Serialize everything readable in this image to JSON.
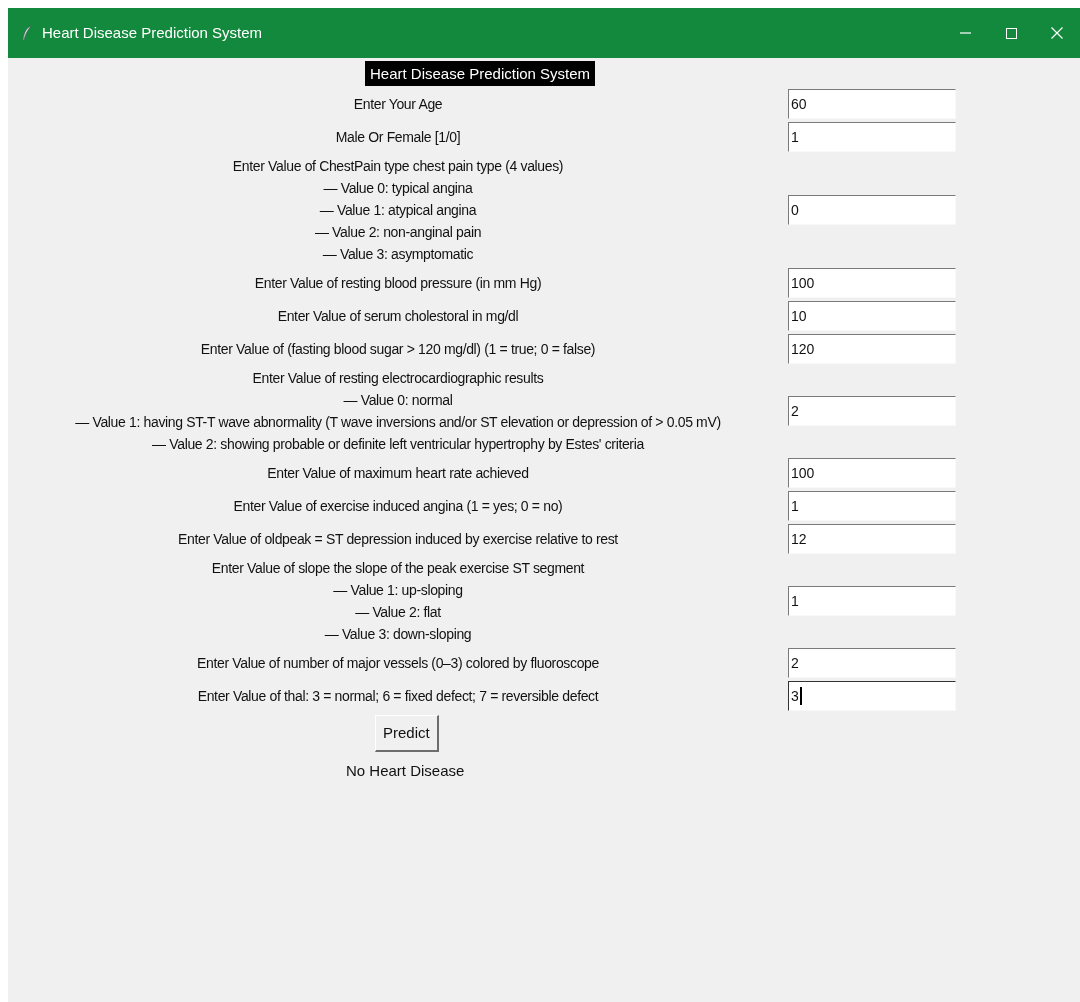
{
  "window": {
    "title": "Heart Disease Prediction System"
  },
  "heading": "Heart Disease Prediction System",
  "fields": [
    {
      "label_lines": [
        "Enter Your Age"
      ],
      "value": "60",
      "focused": false
    },
    {
      "label_lines": [
        "Male Or Female [1/0]"
      ],
      "value": "1",
      "focused": false
    },
    {
      "label_lines": [
        "Enter Value of ChestPain type chest pain type (4 values)",
        "— Value 0: typical angina",
        "— Value 1: atypical angina",
        "— Value 2: non-anginal pain",
        "— Value 3: asymptomatic"
      ],
      "value": "0",
      "focused": false
    },
    {
      "label_lines": [
        "Enter Value of resting blood pressure (in mm Hg)"
      ],
      "value": "100",
      "focused": false
    },
    {
      "label_lines": [
        "Enter Value of serum cholestoral in mg/dl"
      ],
      "value": "10",
      "focused": false
    },
    {
      "label_lines": [
        "Enter Value of (fasting blood sugar > 120 mg/dl) (1 = true; 0 = false)"
      ],
      "value": "120",
      "focused": false
    },
    {
      "label_lines": [
        "Enter Value of resting electrocardiographic results",
        "— Value 0: normal",
        "— Value 1: having ST-T wave abnormality (T wave inversions and/or ST elevation or depression of > 0.05 mV)",
        "— Value 2: showing probable or definite left ventricular hypertrophy by Estes' criteria"
      ],
      "value": "2",
      "focused": false
    },
    {
      "label_lines": [
        "Enter Value of maximum heart rate achieved"
      ],
      "value": "100",
      "focused": false
    },
    {
      "label_lines": [
        "Enter Value of exercise induced angina (1 = yes; 0 = no)"
      ],
      "value": "1",
      "focused": false
    },
    {
      "label_lines": [
        "Enter Value of oldpeak = ST depression induced by exercise relative to rest"
      ],
      "value": "12",
      "focused": false
    },
    {
      "label_lines": [
        "Enter Value of slope the slope of the peak exercise ST segment",
        "— Value 1: up-sloping",
        "— Value 2: flat",
        "— Value 3: down-sloping"
      ],
      "value": "1",
      "focused": false
    },
    {
      "label_lines": [
        "Enter Value of number of major vessels (0–3) colored by fluoroscope"
      ],
      "value": "2",
      "focused": false
    },
    {
      "label_lines": [
        "Enter Value of thal: 3 = normal; 6 = fixed defect; 7 = reversible defect"
      ],
      "value": "3",
      "focused": true
    }
  ],
  "button": "Predict",
  "result": "No Heart Disease"
}
